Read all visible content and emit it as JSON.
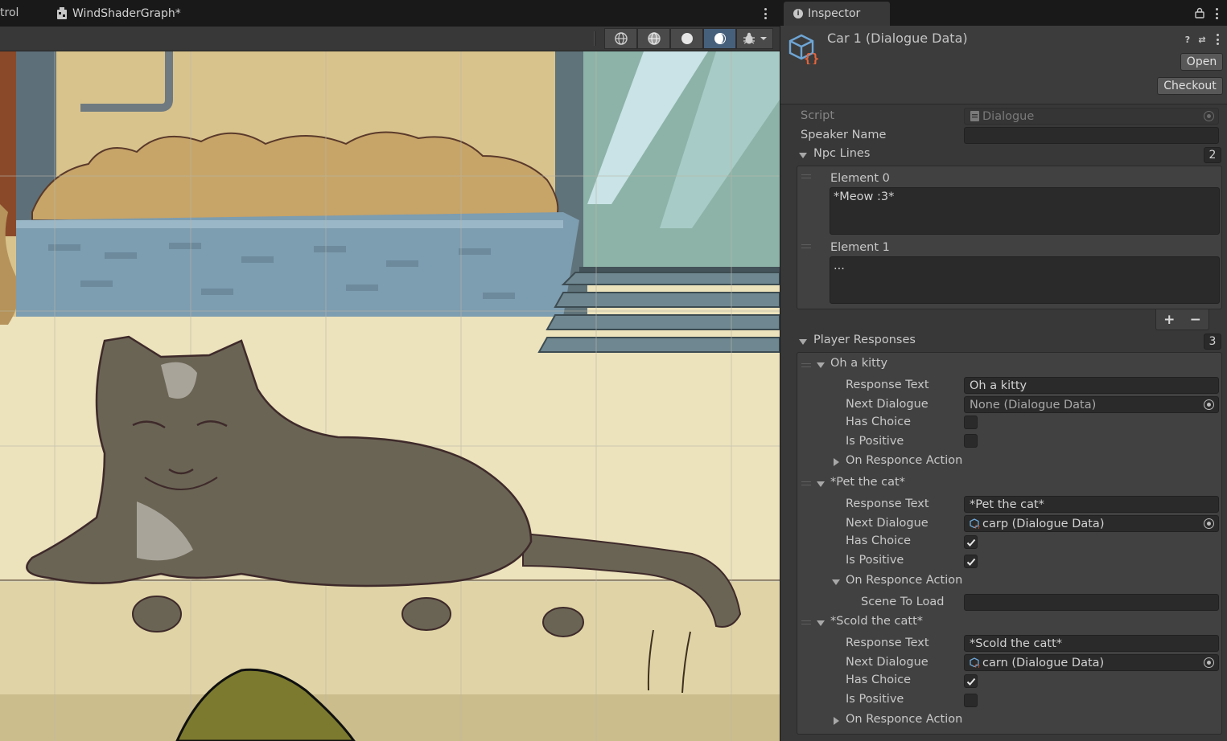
{
  "scene": {
    "prev_tab_label": "trol",
    "active_tab_label": "WindShaderGraph*",
    "toolbar_icons": [
      "wireframe-globe-icon",
      "shaded-globe-icon",
      "solid-sphere-icon",
      "lit-sphere-icon",
      "debug-bug-icon"
    ]
  },
  "inspector": {
    "tab_label": "Inspector",
    "title": "Car 1 (Dialogue Data)",
    "open_label": "Open",
    "checkout_label": "Checkout",
    "script_label": "Script",
    "script_value": "Dialogue",
    "speaker_name_label": "Speaker Name",
    "speaker_name_value": "",
    "npc_lines": {
      "label": "Npc Lines",
      "count": "2",
      "elements": [
        {
          "label": "Element 0",
          "value": "*Meow :3*"
        },
        {
          "label": "Element 1",
          "value": "..."
        }
      ],
      "add_label": "+",
      "remove_label": "−"
    },
    "player_responses": {
      "label": "Player Responses",
      "count": "3",
      "items": [
        {
          "header": "Oh a kitty",
          "response_text_label": "Response Text",
          "response_text": "Oh a kitty",
          "next_dialogue_label": "Next Dialogue",
          "next_dialogue": "None (Dialogue Data)",
          "has_choice_label": "Has Choice",
          "has_choice": false,
          "is_positive_label": "Is Positive",
          "is_positive": false,
          "action_label": "On Responce Action",
          "action_expanded": false
        },
        {
          "header": "*Pet the cat*",
          "response_text_label": "Response Text",
          "response_text": "*Pet the cat*",
          "next_dialogue_label": "Next Dialogue",
          "next_dialogue": "carp (Dialogue Data)",
          "has_choice_label": "Has Choice",
          "has_choice": true,
          "is_positive_label": "Is Positive",
          "is_positive": true,
          "action_label": "On Responce Action",
          "action_expanded": true,
          "scene_to_load_label": "Scene To Load",
          "scene_to_load": ""
        },
        {
          "header": "*Scold the catt*",
          "response_text_label": "Response Text",
          "response_text": "*Scold the catt*",
          "next_dialogue_label": "Next Dialogue",
          "next_dialogue": "carn (Dialogue Data)",
          "has_choice_label": "Has Choice",
          "has_choice": true,
          "is_positive_label": "Is Positive",
          "is_positive": false,
          "action_label": "On Responce Action",
          "action_expanded": false
        }
      ]
    }
  },
  "colors": {
    "accent_blue": "#46607c",
    "panel_bg": "#383838",
    "field_bg": "#2a2a2a"
  }
}
